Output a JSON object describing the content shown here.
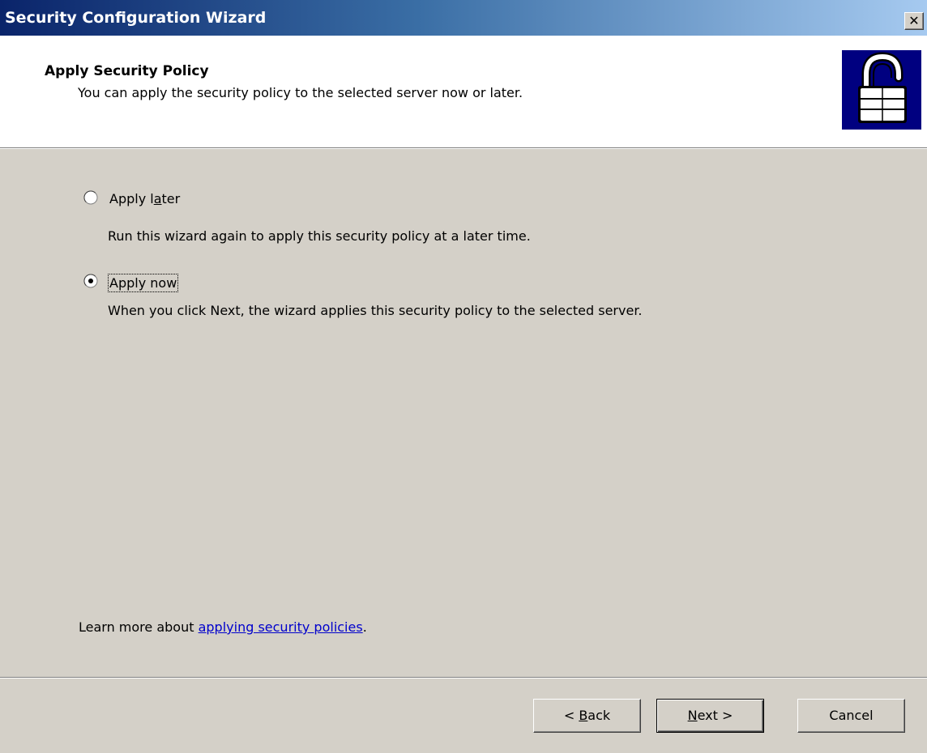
{
  "window": {
    "title": "Security Configuration Wizard",
    "close_glyph": "✕"
  },
  "header": {
    "title": "Apply Security Policy",
    "subtitle": "You can apply the security policy to the selected server now or later.",
    "icon": "lock-icon"
  },
  "options": {
    "apply_later": {
      "label_pre": "Apply l",
      "label_accel": "a",
      "label_post": "ter",
      "description": "Run this wizard again to apply this security policy at a later time.",
      "selected": false
    },
    "apply_now": {
      "label": "Apply now",
      "description": "When you click Next, the wizard applies this security policy to the selected server.",
      "selected": true
    }
  },
  "learn_more": {
    "prefix": "Learn more about ",
    "link_text": "applying security policies",
    "suffix": "."
  },
  "buttons": {
    "back": {
      "pre": "< ",
      "accel": "B",
      "post": "ack"
    },
    "next": {
      "accel": "N",
      "post": "ext >"
    },
    "cancel": {
      "label": "Cancel"
    }
  },
  "colors": {
    "title_bar_start": "#0a246a",
    "title_bar_end": "#a6caf0",
    "dialog_background": "#d4d0c8",
    "link": "#0000cc",
    "icon_background": "#000080"
  }
}
